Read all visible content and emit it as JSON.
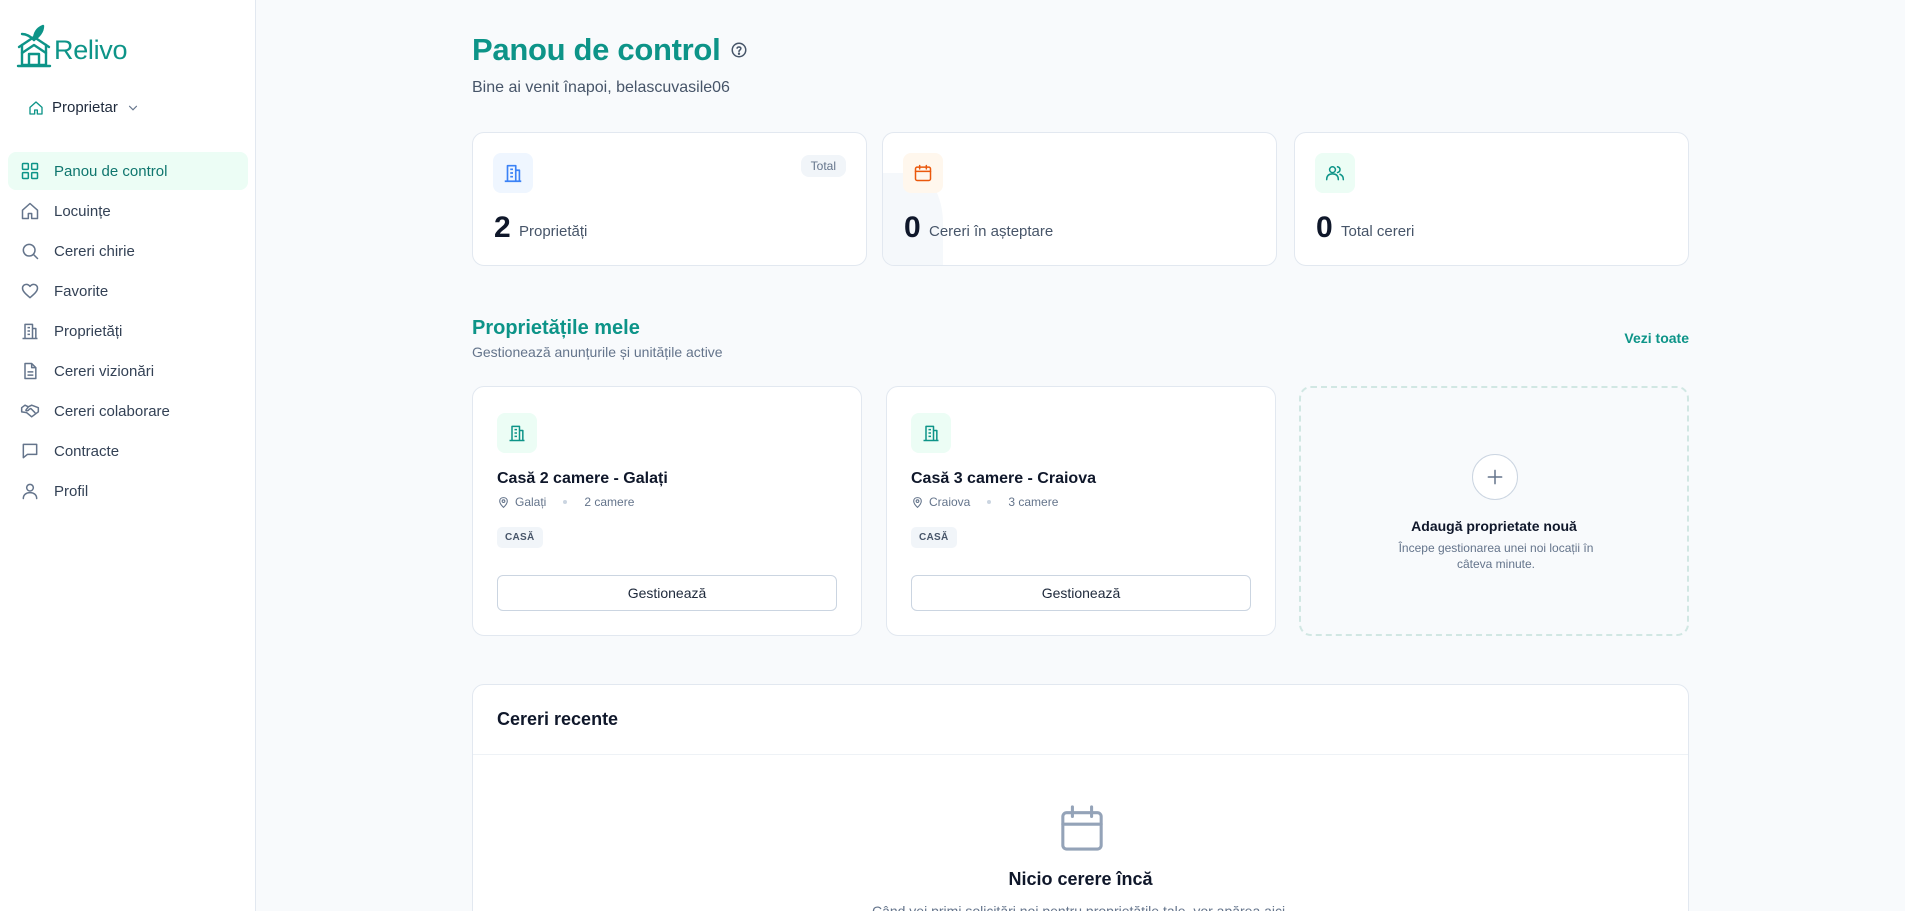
{
  "brand": {
    "name": "Relivo"
  },
  "role": {
    "label": "Proprietar"
  },
  "nav": [
    {
      "label": "Panou de control",
      "icon": "grid-icon",
      "active": true
    },
    {
      "label": "Locuințe",
      "icon": "home-icon"
    },
    {
      "label": "Cereri chirie",
      "icon": "search-icon"
    },
    {
      "label": "Favorite",
      "icon": "heart-icon"
    },
    {
      "label": "Proprietăți",
      "icon": "building-icon"
    },
    {
      "label": "Cereri vizionări",
      "icon": "document-icon"
    },
    {
      "label": "Cereri colaborare",
      "icon": "handshake-icon"
    },
    {
      "label": "Contracte",
      "icon": "chat-icon"
    },
    {
      "label": "Profil",
      "icon": "user-icon"
    }
  ],
  "header": {
    "title": "Panou de control",
    "subtitle": "Bine ai venit înapoi, belascuvasile06"
  },
  "stats": [
    {
      "value": "2",
      "label": "Proprietăți",
      "badge": "Total",
      "icon": "building-icon",
      "color": "#3b82f6"
    },
    {
      "value": "0",
      "label": "Cereri în așteptare",
      "icon": "calendar-icon",
      "color": "#ea580c"
    },
    {
      "value": "0",
      "label": "Total cereri",
      "icon": "users-icon",
      "color": "#0d9488"
    }
  ],
  "properties_section": {
    "title": "Proprietățile mele",
    "subtitle": "Gestionează anunțurile și unitățile active",
    "view_all": "Vezi toate"
  },
  "properties": [
    {
      "name": "Casă 2 camere - Galați",
      "city": "Galați",
      "rooms": "2 camere",
      "tag": "CASĂ",
      "action": "Gestionează"
    },
    {
      "name": "Casă 3 camere - Craiova",
      "city": "Craiova",
      "rooms": "3 camere",
      "tag": "CASĂ",
      "action": "Gestionează"
    }
  ],
  "add_property": {
    "title": "Adaugă proprietate nouă",
    "description": "Începe gestionarea unei noi locații în câteva minute."
  },
  "recent": {
    "title": "Cereri recente",
    "empty_title": "Nicio cerere încă",
    "empty_desc": "Când vei primi solicitări noi pentru proprietățile tale, vor apărea aici."
  },
  "colors": {
    "accent": "#0d9488",
    "accent_bg": "#ecfdf5"
  }
}
